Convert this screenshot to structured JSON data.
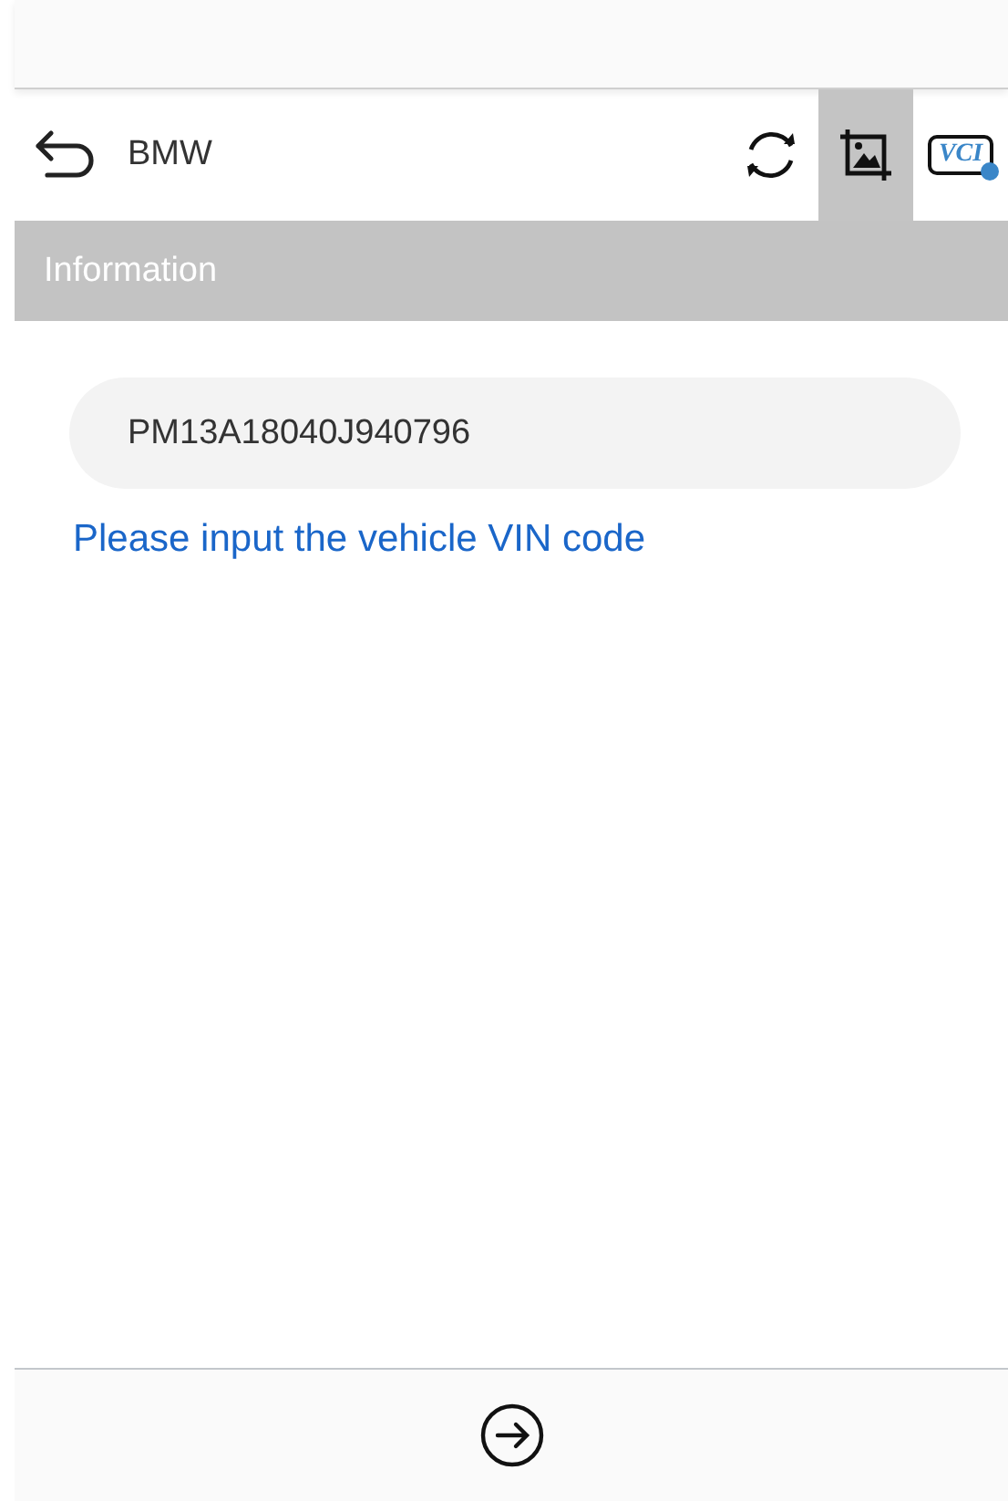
{
  "header": {
    "title": "BMW",
    "tools": [
      {
        "kind": "refresh",
        "selected": false
      },
      {
        "kind": "image",
        "selected": true
      },
      {
        "kind": "vci",
        "label": "VCI",
        "selected": false
      }
    ]
  },
  "section": {
    "title": "Information"
  },
  "vin_field": {
    "value": "PM13A18040J940796"
  },
  "hint": "Please input the vehicle VIN code"
}
